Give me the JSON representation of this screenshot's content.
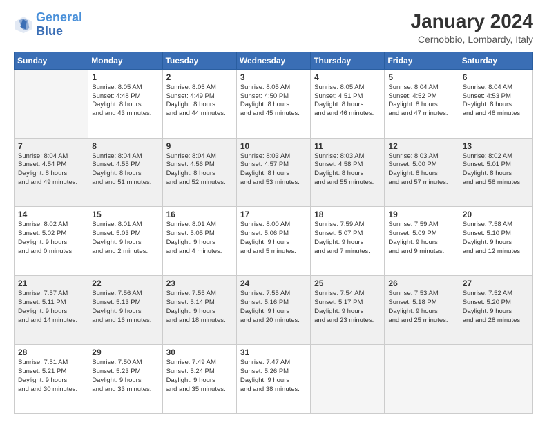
{
  "header": {
    "logo_line1": "General",
    "logo_line2": "Blue",
    "title": "January 2024",
    "subtitle": "Cernobbio, Lombardy, Italy"
  },
  "weekdays": [
    "Sunday",
    "Monday",
    "Tuesday",
    "Wednesday",
    "Thursday",
    "Friday",
    "Saturday"
  ],
  "weeks": [
    [
      {
        "num": "",
        "sunrise": "",
        "sunset": "",
        "daylight": ""
      },
      {
        "num": "1",
        "sunrise": "Sunrise: 8:05 AM",
        "sunset": "Sunset: 4:48 PM",
        "daylight": "Daylight: 8 hours and 43 minutes."
      },
      {
        "num": "2",
        "sunrise": "Sunrise: 8:05 AM",
        "sunset": "Sunset: 4:49 PM",
        "daylight": "Daylight: 8 hours and 44 minutes."
      },
      {
        "num": "3",
        "sunrise": "Sunrise: 8:05 AM",
        "sunset": "Sunset: 4:50 PM",
        "daylight": "Daylight: 8 hours and 45 minutes."
      },
      {
        "num": "4",
        "sunrise": "Sunrise: 8:05 AM",
        "sunset": "Sunset: 4:51 PM",
        "daylight": "Daylight: 8 hours and 46 minutes."
      },
      {
        "num": "5",
        "sunrise": "Sunrise: 8:04 AM",
        "sunset": "Sunset: 4:52 PM",
        "daylight": "Daylight: 8 hours and 47 minutes."
      },
      {
        "num": "6",
        "sunrise": "Sunrise: 8:04 AM",
        "sunset": "Sunset: 4:53 PM",
        "daylight": "Daylight: 8 hours and 48 minutes."
      }
    ],
    [
      {
        "num": "7",
        "sunrise": "Sunrise: 8:04 AM",
        "sunset": "Sunset: 4:54 PM",
        "daylight": "Daylight: 8 hours and 49 minutes."
      },
      {
        "num": "8",
        "sunrise": "Sunrise: 8:04 AM",
        "sunset": "Sunset: 4:55 PM",
        "daylight": "Daylight: 8 hours and 51 minutes."
      },
      {
        "num": "9",
        "sunrise": "Sunrise: 8:04 AM",
        "sunset": "Sunset: 4:56 PM",
        "daylight": "Daylight: 8 hours and 52 minutes."
      },
      {
        "num": "10",
        "sunrise": "Sunrise: 8:03 AM",
        "sunset": "Sunset: 4:57 PM",
        "daylight": "Daylight: 8 hours and 53 minutes."
      },
      {
        "num": "11",
        "sunrise": "Sunrise: 8:03 AM",
        "sunset": "Sunset: 4:58 PM",
        "daylight": "Daylight: 8 hours and 55 minutes."
      },
      {
        "num": "12",
        "sunrise": "Sunrise: 8:03 AM",
        "sunset": "Sunset: 5:00 PM",
        "daylight": "Daylight: 8 hours and 57 minutes."
      },
      {
        "num": "13",
        "sunrise": "Sunrise: 8:02 AM",
        "sunset": "Sunset: 5:01 PM",
        "daylight": "Daylight: 8 hours and 58 minutes."
      }
    ],
    [
      {
        "num": "14",
        "sunrise": "Sunrise: 8:02 AM",
        "sunset": "Sunset: 5:02 PM",
        "daylight": "Daylight: 9 hours and 0 minutes."
      },
      {
        "num": "15",
        "sunrise": "Sunrise: 8:01 AM",
        "sunset": "Sunset: 5:03 PM",
        "daylight": "Daylight: 9 hours and 2 minutes."
      },
      {
        "num": "16",
        "sunrise": "Sunrise: 8:01 AM",
        "sunset": "Sunset: 5:05 PM",
        "daylight": "Daylight: 9 hours and 4 minutes."
      },
      {
        "num": "17",
        "sunrise": "Sunrise: 8:00 AM",
        "sunset": "Sunset: 5:06 PM",
        "daylight": "Daylight: 9 hours and 5 minutes."
      },
      {
        "num": "18",
        "sunrise": "Sunrise: 7:59 AM",
        "sunset": "Sunset: 5:07 PM",
        "daylight": "Daylight: 9 hours and 7 minutes."
      },
      {
        "num": "19",
        "sunrise": "Sunrise: 7:59 AM",
        "sunset": "Sunset: 5:09 PM",
        "daylight": "Daylight: 9 hours and 9 minutes."
      },
      {
        "num": "20",
        "sunrise": "Sunrise: 7:58 AM",
        "sunset": "Sunset: 5:10 PM",
        "daylight": "Daylight: 9 hours and 12 minutes."
      }
    ],
    [
      {
        "num": "21",
        "sunrise": "Sunrise: 7:57 AM",
        "sunset": "Sunset: 5:11 PM",
        "daylight": "Daylight: 9 hours and 14 minutes."
      },
      {
        "num": "22",
        "sunrise": "Sunrise: 7:56 AM",
        "sunset": "Sunset: 5:13 PM",
        "daylight": "Daylight: 9 hours and 16 minutes."
      },
      {
        "num": "23",
        "sunrise": "Sunrise: 7:55 AM",
        "sunset": "Sunset: 5:14 PM",
        "daylight": "Daylight: 9 hours and 18 minutes."
      },
      {
        "num": "24",
        "sunrise": "Sunrise: 7:55 AM",
        "sunset": "Sunset: 5:16 PM",
        "daylight": "Daylight: 9 hours and 20 minutes."
      },
      {
        "num": "25",
        "sunrise": "Sunrise: 7:54 AM",
        "sunset": "Sunset: 5:17 PM",
        "daylight": "Daylight: 9 hours and 23 minutes."
      },
      {
        "num": "26",
        "sunrise": "Sunrise: 7:53 AM",
        "sunset": "Sunset: 5:18 PM",
        "daylight": "Daylight: 9 hours and 25 minutes."
      },
      {
        "num": "27",
        "sunrise": "Sunrise: 7:52 AM",
        "sunset": "Sunset: 5:20 PM",
        "daylight": "Daylight: 9 hours and 28 minutes."
      }
    ],
    [
      {
        "num": "28",
        "sunrise": "Sunrise: 7:51 AM",
        "sunset": "Sunset: 5:21 PM",
        "daylight": "Daylight: 9 hours and 30 minutes."
      },
      {
        "num": "29",
        "sunrise": "Sunrise: 7:50 AM",
        "sunset": "Sunset: 5:23 PM",
        "daylight": "Daylight: 9 hours and 33 minutes."
      },
      {
        "num": "30",
        "sunrise": "Sunrise: 7:49 AM",
        "sunset": "Sunset: 5:24 PM",
        "daylight": "Daylight: 9 hours and 35 minutes."
      },
      {
        "num": "31",
        "sunrise": "Sunrise: 7:47 AM",
        "sunset": "Sunset: 5:26 PM",
        "daylight": "Daylight: 9 hours and 38 minutes."
      },
      {
        "num": "",
        "sunrise": "",
        "sunset": "",
        "daylight": ""
      },
      {
        "num": "",
        "sunrise": "",
        "sunset": "",
        "daylight": ""
      },
      {
        "num": "",
        "sunrise": "",
        "sunset": "",
        "daylight": ""
      }
    ]
  ]
}
